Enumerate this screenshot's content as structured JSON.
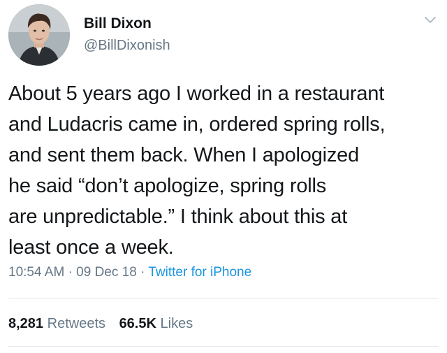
{
  "author": {
    "display_name": "Bill Dixon",
    "handle": "@BillDixonish"
  },
  "tweet": {
    "lines": [
      "About 5 years ago I worked in a restaurant",
      "and Ludacris came in, ordered spring rolls,",
      "and sent them back. When I apologized",
      "he said “don’t apologize, spring rolls",
      "are unpredictable.” I think about this at",
      "least once a week."
    ],
    "time": "10:54 AM",
    "date": "09 Dec 18",
    "separator": "·",
    "source": "Twitter for iPhone"
  },
  "stats": {
    "retweets_count": "8,281",
    "retweets_label": "Retweets",
    "likes_count": "66.5K",
    "likes_label": "Likes"
  },
  "icons": {
    "menu": "chevron-down-icon"
  },
  "colors": {
    "text": "#14171a",
    "secondary": "#657786",
    "link": "#1b95e0",
    "divider": "#e1e8ed"
  }
}
